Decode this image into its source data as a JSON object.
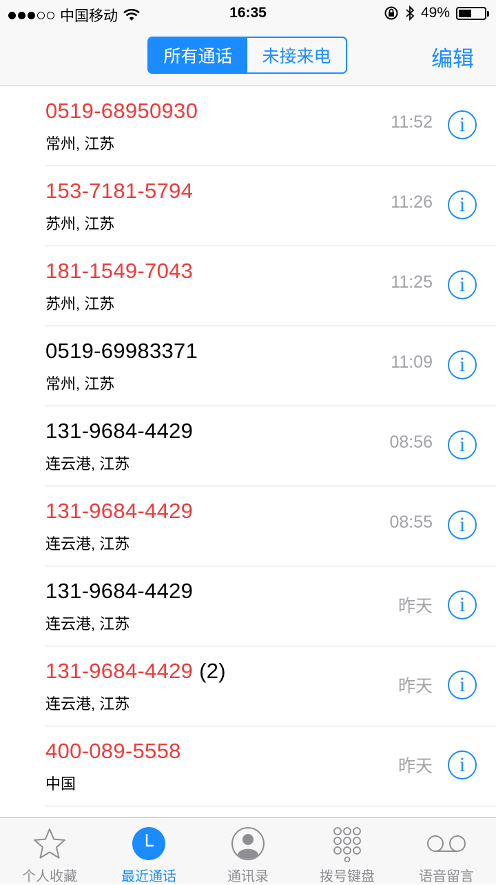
{
  "status": {
    "carrier": "中国移动",
    "time": "16:35",
    "battery": "49%",
    "battery_level": 0.49
  },
  "header": {
    "segments": [
      "所有通话",
      "未接来电"
    ],
    "active_segment": 0,
    "edit_label": "编辑"
  },
  "calls": [
    {
      "number": "0519-68950930",
      "count": "",
      "location": "常州, 江苏",
      "time": "11:52",
      "missed": true
    },
    {
      "number": "153-7181-5794",
      "count": "",
      "location": "苏州, 江苏",
      "time": "11:26",
      "missed": true
    },
    {
      "number": "181-1549-7043",
      "count": "",
      "location": "苏州, 江苏",
      "time": "11:25",
      "missed": true
    },
    {
      "number": "0519-69983371",
      "count": "",
      "location": "常州, 江苏",
      "time": "11:09",
      "missed": false
    },
    {
      "number": "131-9684-4429",
      "count": "",
      "location": "连云港, 江苏",
      "time": "08:56",
      "missed": false
    },
    {
      "number": "131-9684-4429",
      "count": "",
      "location": "连云港, 江苏",
      "time": "08:55",
      "missed": true
    },
    {
      "number": "131-9684-4429",
      "count": "",
      "location": "连云港, 江苏",
      "time": "昨天",
      "missed": false
    },
    {
      "number": "131-9684-4429",
      "count": "(2)",
      "location": "连云港, 江苏",
      "time": "昨天",
      "missed": true
    },
    {
      "number": "400-089-5558",
      "count": "",
      "location": "中国",
      "time": "昨天",
      "missed": true
    }
  ],
  "info_glyph": "i",
  "tabbar": {
    "tabs": [
      {
        "label": "个人收藏",
        "icon": "star-icon"
      },
      {
        "label": "最近通话",
        "icon": "clock-icon"
      },
      {
        "label": "通讯录",
        "icon": "contact-icon"
      },
      {
        "label": "拨号键盘",
        "icon": "keypad-icon"
      },
      {
        "label": "语音留言",
        "icon": "voicemail-icon"
      }
    ],
    "active": 1
  },
  "colors": {
    "accent": "#1a8cff",
    "missed": "#ee3b3b",
    "secondary": "#a3a3a8"
  }
}
